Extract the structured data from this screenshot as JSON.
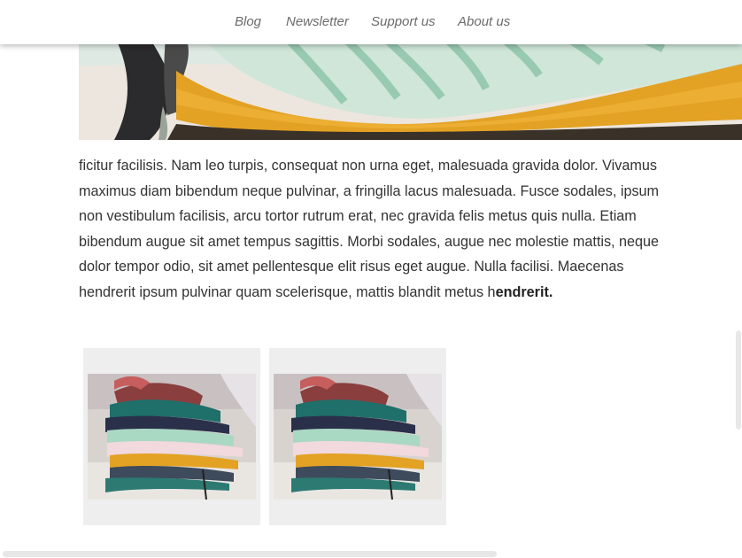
{
  "nav": {
    "items": [
      {
        "label": "Blog"
      },
      {
        "label": "Newsletter"
      },
      {
        "label": "Support us"
      },
      {
        "label": "About us"
      }
    ]
  },
  "article": {
    "paragraph": "ficitur facilisis. Nam leo turpis, consequat non urna eget, malesuada gravida dolor. Vivamus maximus diam bibendum neque pulvinar, a fringilla lacus malesuada. Fusce sodales, ipsum non vestibulum facilisis, arcu tortor rutrum erat, nec gravida felis metus quis nulla. Etiam bibendum augue sit amet tempus sagittis. Morbi sodales, augue nec molestie mattis, neque dolor tempor odio, sit amet pellentesque elit risus eget augue. Nulla facilisi. Maecenas hendrerit ipsum pulvinar quam scelerisque, mattis blandit metus h",
    "bold_tail": "endrerit."
  },
  "images": {
    "hero": "folded-clothes-photo",
    "gallery": [
      "clothes-pile-photo",
      "clothes-pile-photo"
    ]
  },
  "colors": {
    "nav_text": "#6b6b6b",
    "body_text": "#333333",
    "card_bg": "#eeeeee",
    "mustard": "#e0a22a",
    "mint_stripe": "#9fd0b8"
  }
}
